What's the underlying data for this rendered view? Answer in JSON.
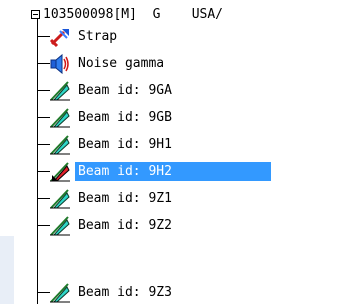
{
  "root": {
    "label": "103500098[M]  G    USA/"
  },
  "items": [
    {
      "label": "Strap",
      "icon": "strap-icon"
    },
    {
      "label": "Noise gamma",
      "icon": "speaker-icon"
    },
    {
      "label": "Beam id: 9GA",
      "icon": "beam-icon"
    },
    {
      "label": "Beam id: 9GB",
      "icon": "beam-icon"
    },
    {
      "label": "Beam id: 9H1",
      "icon": "beam-icon"
    },
    {
      "label": "Beam id: 9H2",
      "icon": "beam-icon-selected",
      "selected": true
    },
    {
      "label": "Beam id: 9Z1",
      "icon": "beam-icon"
    },
    {
      "label": "Beam id: 9Z2",
      "icon": "beam-icon"
    },
    {
      "label": "Beam id: 9Z3",
      "icon": "beam-icon"
    }
  ],
  "colors": {
    "selection": "#3399ff",
    "beam_cyan": "#2fd6c8",
    "beam_green": "#1f7a2a",
    "beam_red": "#e0202a"
  }
}
